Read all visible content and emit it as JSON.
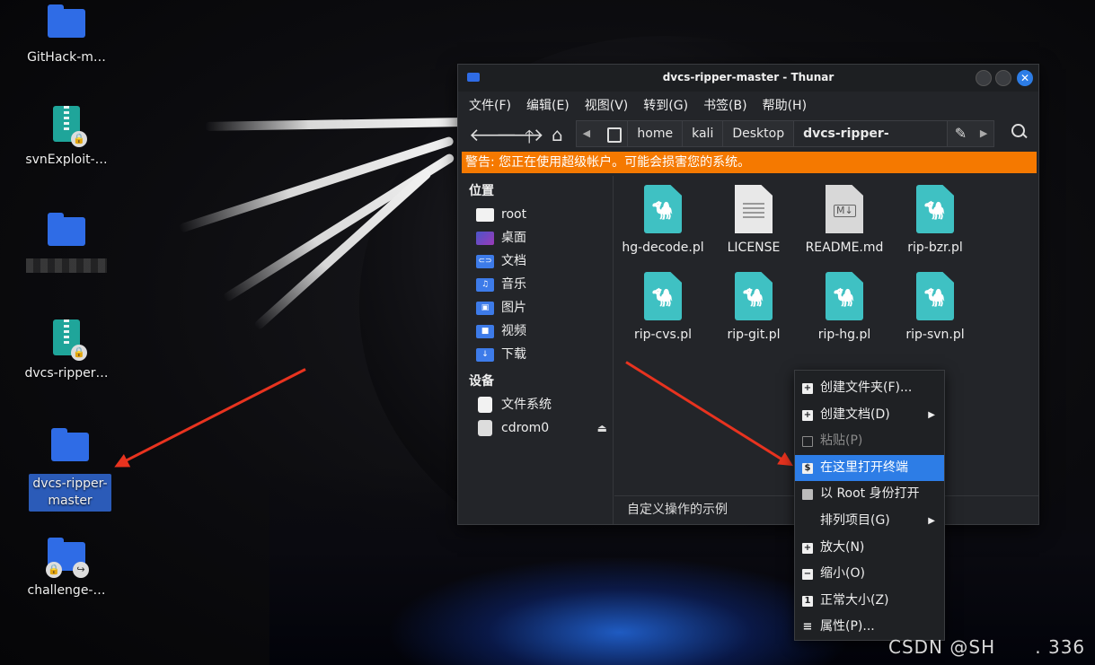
{
  "desktop": {
    "icons": [
      {
        "label": "GitHack-m…",
        "type": "folder"
      },
      {
        "label": "svnExploit-…",
        "type": "archive"
      },
      {
        "label": "",
        "type": "folder"
      },
      {
        "label": "dvcs-ripper…",
        "type": "archive"
      },
      {
        "label": "dvcs-ripper-master",
        "type": "folder"
      },
      {
        "label": "challenge-…",
        "type": "folder"
      }
    ]
  },
  "window": {
    "title": "dvcs-ripper-master - Thunar",
    "menu": [
      "文件(F)",
      "编辑(E)",
      "视图(V)",
      "转到(G)",
      "书签(B)",
      "帮助(H)"
    ],
    "path": [
      "home",
      "kali",
      "Desktop",
      "dvcs-ripper-master"
    ],
    "warning": "警告: 您正在使用超级帐户。可能会损害您的系统。",
    "sidebar": {
      "places_header": "位置",
      "places": [
        "root",
        "桌面",
        "文档",
        "音乐",
        "图片",
        "视频",
        "下载"
      ],
      "devices_header": "设备",
      "devices": [
        "文件系统",
        "cdrom0"
      ]
    },
    "files": [
      {
        "name": "hg-decode.pl",
        "kind": "perl"
      },
      {
        "name": "LICENSE",
        "kind": "text"
      },
      {
        "name": "README.md",
        "kind": "markdown"
      },
      {
        "name": "rip-bzr.pl",
        "kind": "perl"
      },
      {
        "name": "rip-cvs.pl",
        "kind": "perl"
      },
      {
        "name": "rip-git.pl",
        "kind": "perl"
      },
      {
        "name": "rip-hg.pl",
        "kind": "perl"
      },
      {
        "name": "rip-svn.pl",
        "kind": "perl"
      }
    ],
    "status": "自定义操作的示例"
  },
  "context_menu": {
    "items": [
      {
        "label": "创建文件夹(F)...",
        "icon": "plus-icon",
        "submenu": false,
        "disabled": false
      },
      {
        "label": "创建文档(D)",
        "icon": "plus-icon",
        "submenu": true,
        "disabled": false
      },
      {
        "label": "粘贴(P)",
        "icon": "clipboard-icon",
        "submenu": false,
        "disabled": true
      },
      {
        "label": "在这里打开终端",
        "icon": "terminal-icon",
        "submenu": false,
        "disabled": false,
        "highlighted": true
      },
      {
        "label": "以 Root 身份打开",
        "icon": "folder-icon",
        "submenu": false,
        "disabled": false
      },
      {
        "label": "排列项目(G)",
        "icon": "",
        "submenu": true,
        "disabled": false
      },
      {
        "label": "放大(N)",
        "icon": "zoom-in-icon",
        "submenu": false,
        "disabled": false
      },
      {
        "label": "缩小(O)",
        "icon": "zoom-out-icon",
        "submenu": false,
        "disabled": false
      },
      {
        "label": "正常大小(Z)",
        "icon": "normal-size-icon",
        "submenu": false,
        "disabled": false
      },
      {
        "label": "属性(P)...",
        "icon": "properties-icon",
        "submenu": false,
        "disabled": false
      }
    ]
  },
  "watermark": "CSDN @SH      . 336",
  "colors": {
    "warning": "#f57900",
    "highlight": "#2d7de6",
    "folder": "#2f6ce6",
    "arrow": "#e8331f"
  }
}
